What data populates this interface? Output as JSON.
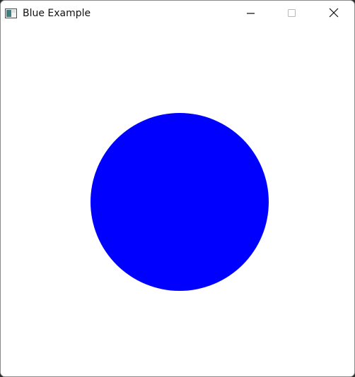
{
  "window": {
    "title": "Blue Example",
    "icon": "app-window-icon",
    "controls": {
      "minimize_icon": "minimize-icon",
      "maximize_icon": "maximize-icon",
      "close_icon": "close-icon"
    }
  },
  "canvas": {
    "background_color": "#ffffff",
    "shape": "circle",
    "fill_color": "#0000ff"
  }
}
